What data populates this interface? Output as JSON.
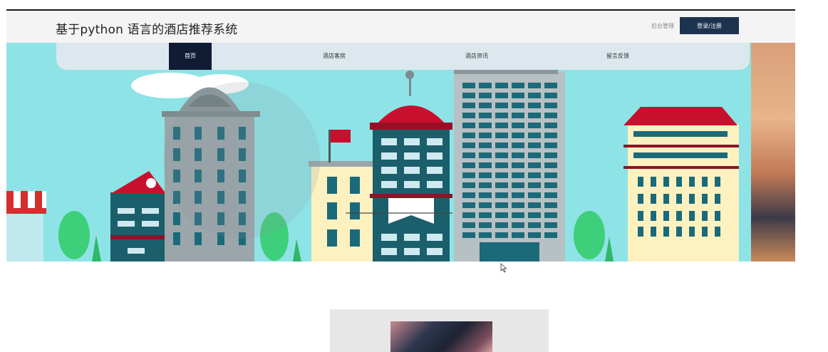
{
  "header": {
    "site_title": "基于python 语言的酒店推荐系统",
    "admin_link": "后台管理",
    "login_button": "登录/注册"
  },
  "nav": {
    "items": [
      {
        "label": "首页",
        "active": true
      },
      {
        "label": "酒店客房",
        "active": false
      },
      {
        "label": "酒店资讯",
        "active": false
      },
      {
        "label": "留言反馈",
        "active": false
      }
    ],
    "active_color": "#0f1c33"
  },
  "banner": {
    "description_colors": {
      "sky": "#8ee3e6",
      "building_teal": "#1b6a7a",
      "roof_red": "#c8102e"
    }
  }
}
